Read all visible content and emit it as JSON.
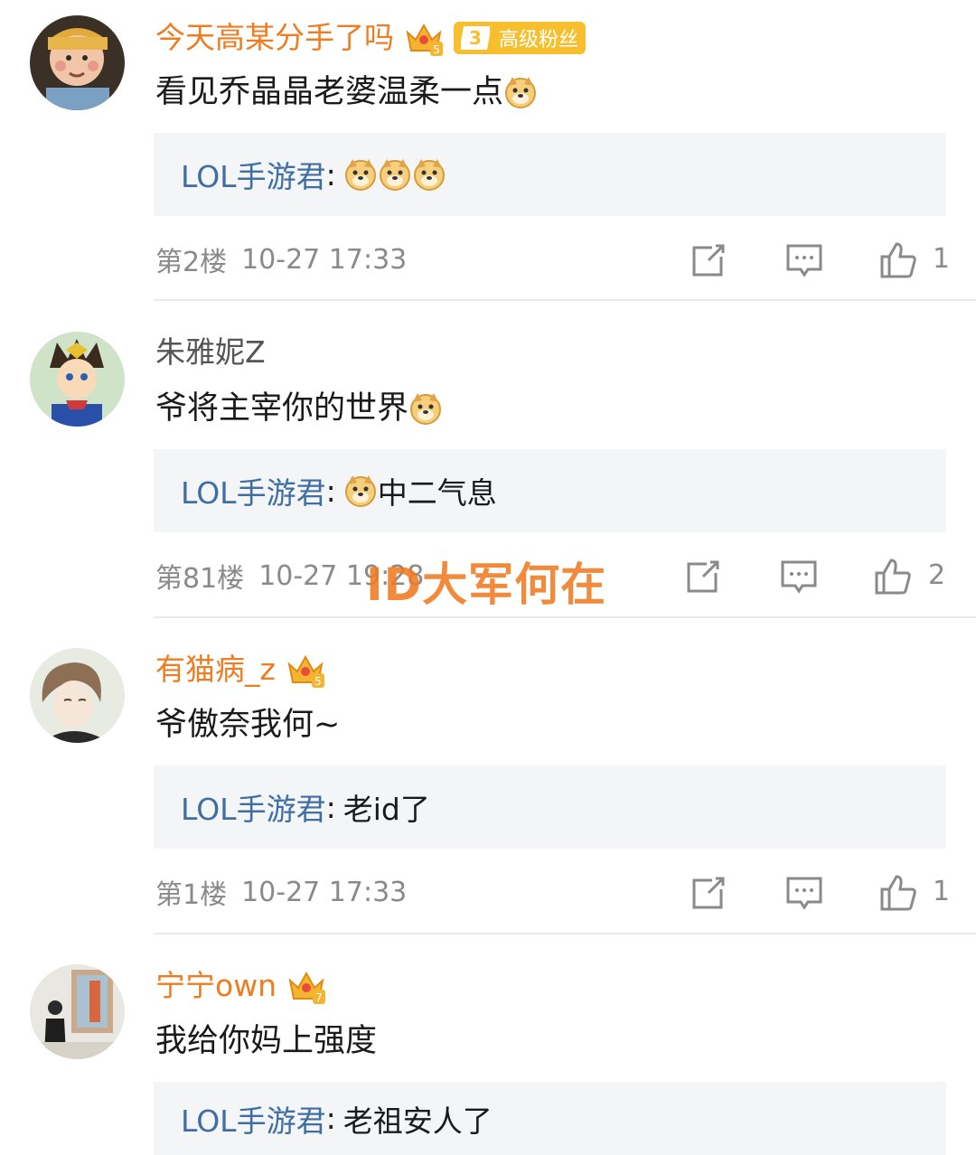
{
  "comments": [
    {
      "username": "今天高某分手了吗",
      "user_type": "vip",
      "crown_level": "5",
      "fan_badge_level": "3",
      "fan_badge_text": "高级粉丝",
      "content": "看见乔晶晶老婆温柔一点",
      "reply_author": "LOL手游君",
      "reply_sep": ":",
      "reply_text": "",
      "floor": "第2楼",
      "time": "10-27 17:33",
      "likes": "1"
    },
    {
      "username": "朱雅妮Z",
      "user_type": "normal",
      "content": "爷将主宰你的世界",
      "reply_author": "LOL手游君",
      "reply_sep": ":",
      "reply_text": "中二气息",
      "floor": "第81楼",
      "time": "10-27 19:28",
      "likes": "2"
    },
    {
      "username": "有猫病_z",
      "user_type": "vip",
      "crown_level": "5",
      "content": "爷傲奈我何~",
      "reply_author": "LOL手游君",
      "reply_sep": ":",
      "reply_text": "老id了",
      "floor": "第1楼",
      "time": "10-27 17:33",
      "likes": "1"
    },
    {
      "username": "宁宁own",
      "user_type": "vip",
      "crown_level": "7",
      "content": "我给你妈上强度",
      "reply_author": "LOL手游君",
      "reply_sep": ":",
      "reply_text": "老祖安人了"
    }
  ],
  "watermark": "ID大军何在",
  "colors": {
    "vip_name": "#f07c21",
    "reply_author": "#3f6ea3",
    "meta": "#8a8a8a",
    "reply_bg": "#f4f5f7"
  }
}
